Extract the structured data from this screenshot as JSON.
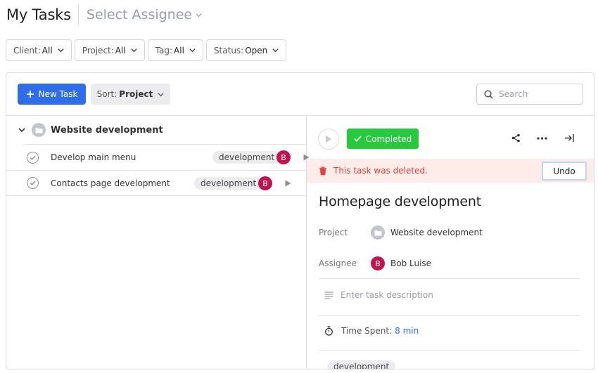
{
  "header": {
    "title": "My Tasks",
    "assignee_selector": "Select Assignee"
  },
  "filters": [
    {
      "label": "Client:",
      "value": "All"
    },
    {
      "label": "Project:",
      "value": "All"
    },
    {
      "label": "Tag:",
      "value": "All"
    },
    {
      "label": "Status:",
      "value": "Open"
    }
  ],
  "toolbar": {
    "new_task_label": "New Task",
    "sort_label": "Sort:",
    "sort_value": "Project",
    "search_placeholder": "Search"
  },
  "task_list": {
    "group_name": "Website development",
    "tasks": [
      {
        "name": "Develop main menu",
        "tag": "development",
        "assignee_initial": "B"
      },
      {
        "name": "Contacts page development",
        "tag": "development",
        "assignee_initial": "B"
      }
    ]
  },
  "detail": {
    "status_label": "Completed",
    "alert_text": "This task was deleted.",
    "undo_label": "Undo",
    "task_title": "Homepage development",
    "project_label": "Project",
    "project_value": "Website development",
    "assignee_label": "Assignee",
    "assignee_initial": "B",
    "assignee_name": "Bob Luise",
    "description_placeholder": "Enter task description",
    "time_spent_label": "Time Spent:",
    "time_spent_value": "8 min",
    "tag": "development"
  },
  "colors": {
    "primary": "#2f6ee8",
    "completed": "#27c93f",
    "avatar": "#c3134f",
    "alert_bg": "#fdecea",
    "alert_text": "#e0413a"
  },
  "icons": [
    "chevron-down-icon",
    "plus-icon",
    "search-icon",
    "folder-icon",
    "check-circle-icon",
    "play-icon",
    "share-icon",
    "more-icon",
    "collapse-panel-icon",
    "trash-icon",
    "description-icon",
    "stopwatch-icon"
  ]
}
